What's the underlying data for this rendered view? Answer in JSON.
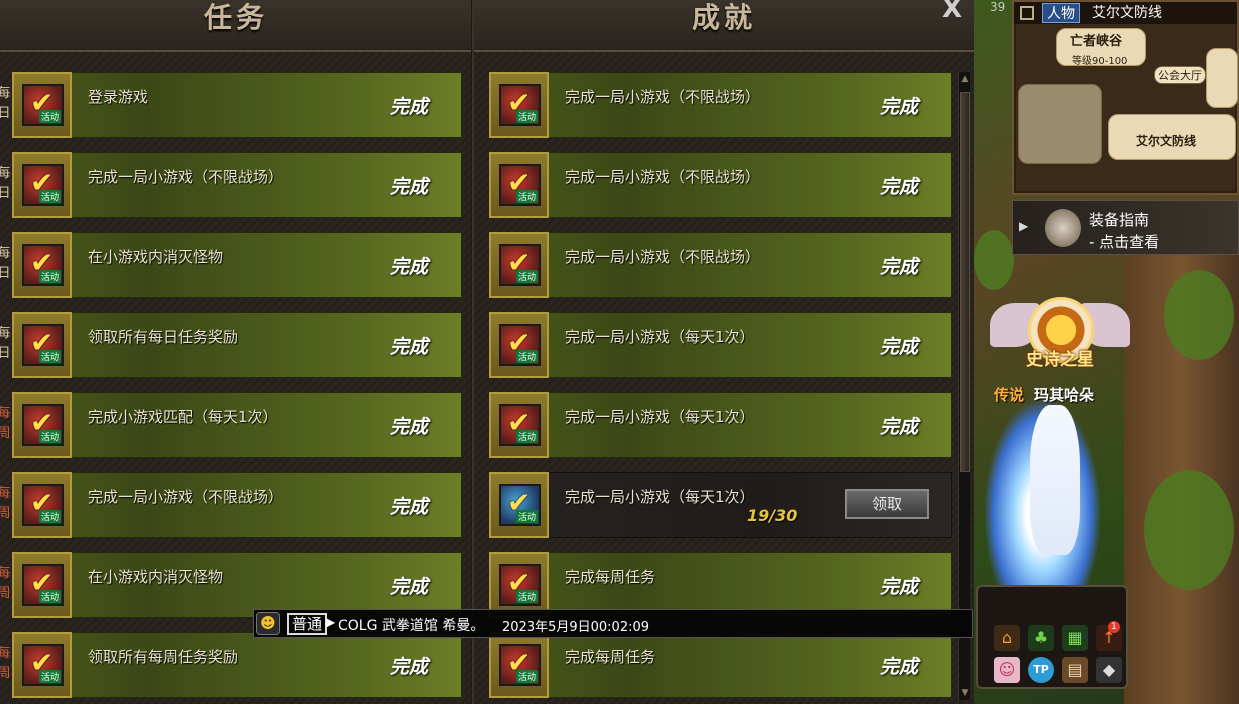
{
  "tasks": {
    "title": "任务",
    "rows": [
      {
        "cycle": "每日",
        "label": "登录游戏",
        "status": "完成",
        "icon": "check-icon"
      },
      {
        "cycle": "每日",
        "label": "完成一局小游戏（不限战场）",
        "status": "完成",
        "icon": "check-icon"
      },
      {
        "cycle": "每日",
        "label": "在小游戏内消灭怪物",
        "status": "完成",
        "icon": "check-icon"
      },
      {
        "cycle": "每日",
        "label": "领取所有每日任务奖励",
        "status": "完成",
        "icon": "check-icon"
      },
      {
        "cycle": "每周",
        "label": "完成小游戏匹配（每天1次）",
        "status": "完成",
        "icon": "check-icon"
      },
      {
        "cycle": "每周",
        "label": "完成一局小游戏（不限战场）",
        "status": "完成",
        "icon": "check-icon"
      },
      {
        "cycle": "每周",
        "label": "在小游戏内消灭怪物",
        "status": "完成",
        "icon": "check-icon"
      },
      {
        "cycle": "每周",
        "label": "领取所有每周任务奖励",
        "status": "完成",
        "icon": "check-icon"
      }
    ]
  },
  "achievements": {
    "title": "成就",
    "close": "X",
    "rows": [
      {
        "label": "完成一局小游戏（不限战场）",
        "status": "完成"
      },
      {
        "label": "完成一局小游戏（不限战场）",
        "status": "完成"
      },
      {
        "label": "完成一局小游戏（不限战场）",
        "status": "完成"
      },
      {
        "label": "完成一局小游戏（每天1次）",
        "status": "完成"
      },
      {
        "label": "完成一局小游戏（每天1次）",
        "status": "完成"
      },
      {
        "label": "完成一局小游戏（每天1次）",
        "progress": "19/30",
        "button": "领取"
      },
      {
        "label": "完成每周任务",
        "status": "完成"
      },
      {
        "label": "完成每周任务",
        "status": "完成"
      }
    ]
  },
  "icon_tag": "活动",
  "map": {
    "channel_num": "39",
    "tab": "人物",
    "area": "艾尔文防线",
    "region": "亡者峡谷",
    "level": "等级90-100",
    "guild_hall": "公会大厅",
    "town": "艾尔文防线"
  },
  "guide": {
    "title": "装备指南",
    "subtitle": "- 点击查看"
  },
  "character": {
    "epic_title": "史诗之星",
    "title": "传说",
    "name": "玛其哈朵"
  },
  "hotbar": {
    "badge": "1"
  },
  "chat": {
    "channel": "普通",
    "message": "COLG 武拳道馆 希曼。",
    "time": "2023年5月9日00:02:09"
  },
  "colors": {
    "complete_row": "#55661f",
    "progress_text": "#e6c23e",
    "week_cycle": "#d35b3a"
  }
}
